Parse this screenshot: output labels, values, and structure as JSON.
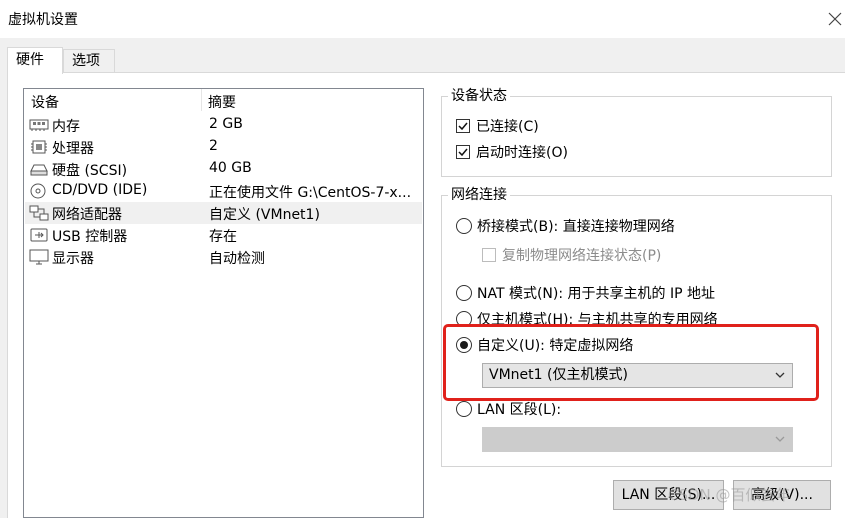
{
  "window": {
    "title": "虚拟机设置"
  },
  "tabs": [
    {
      "label": "硬件",
      "active": true
    },
    {
      "label": "选项",
      "active": false
    }
  ],
  "device_list": {
    "columns": [
      "设备",
      "摘要"
    ],
    "rows": [
      {
        "icon": "memory-icon",
        "name": "内存",
        "summary": "2 GB",
        "selected": false
      },
      {
        "icon": "processor-icon",
        "name": "处理器",
        "summary": "2",
        "selected": false
      },
      {
        "icon": "hard-disk-icon",
        "name": "硬盘 (SCSI)",
        "summary": "40 GB",
        "selected": false
      },
      {
        "icon": "cd-dvd-icon",
        "name": "CD/DVD (IDE)",
        "summary": "正在使用文件 G:\\CentOS-7-x...",
        "selected": false
      },
      {
        "icon": "network-adapter-icon",
        "name": "网络适配器",
        "summary": "自定义 (VMnet1)",
        "selected": true
      },
      {
        "icon": "usb-controller-icon",
        "name": "USB 控制器",
        "summary": "存在",
        "selected": false
      },
      {
        "icon": "display-icon",
        "name": "显示器",
        "summary": "自动检测",
        "selected": false
      }
    ]
  },
  "device_status": {
    "title": "设备状态",
    "connected": {
      "label": "已连接(C)",
      "checked": true
    },
    "connect_at_power_on": {
      "label": "启动时连接(O)",
      "checked": true
    }
  },
  "network_connection": {
    "title": "网络连接",
    "bridged": {
      "label": "桥接模式(B): 直接连接物理网络",
      "selected": false
    },
    "replicate": {
      "label": "复制物理网络连接状态(P)",
      "checked": false,
      "enabled": false
    },
    "nat": {
      "label": "NAT 模式(N): 用于共享主机的 IP 地址",
      "selected": false
    },
    "host_only": {
      "label": "仅主机模式(H): 与主机共享的专用网络",
      "selected": true
    },
    "custom": {
      "label": "自定义(U): 特定虚拟网络",
      "selected": true
    },
    "custom_select": {
      "value": "VMnet1 (仅主机模式)"
    },
    "lan_segment": {
      "label": "LAN 区段(L):",
      "selected": false
    },
    "lan_select": {
      "value": ""
    }
  },
  "buttons": {
    "lan_segments": "LAN 区段(S)...",
    "advanced": "高级(V)..."
  },
  "watermark": "CSDN @百似尝年",
  "colors": {
    "highlight": "#e0211b",
    "selected_row": "#f0f0f0",
    "dialog_bg": "#f0f0f0"
  }
}
